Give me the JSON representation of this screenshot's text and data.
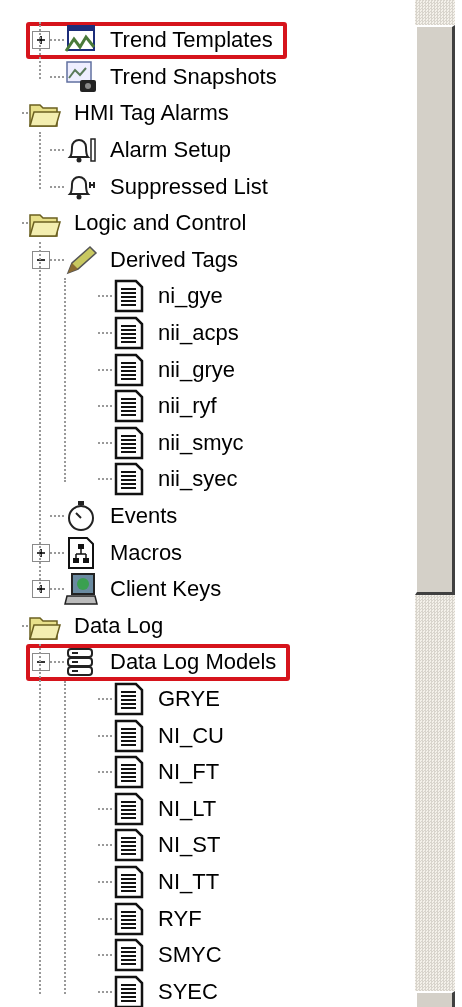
{
  "tree": [
    {
      "children": [
        {
          "label": "Trend Templates",
          "kind": "chart",
          "expanded": false,
          "highlighted": true
        },
        {
          "label": "Trend Snapshots",
          "kind": "snapshot",
          "highlighted": false
        }
      ]
    },
    {
      "label": "HMI Tag Alarms",
      "kind": "folder",
      "highlighted": false,
      "children": [
        {
          "label": "Alarm Setup",
          "kind": "bell",
          "highlighted": false
        },
        {
          "label": "Suppressed List",
          "kind": "bell-muted",
          "highlighted": false
        }
      ]
    },
    {
      "label": "Logic and Control",
      "kind": "folder",
      "highlighted": false,
      "children": [
        {
          "label": "Derived Tags",
          "kind": "pencil",
          "expanded": true,
          "highlighted": false,
          "children": [
            {
              "label": "ni_gye",
              "kind": "document",
              "highlighted": false
            },
            {
              "label": "nii_acps",
              "kind": "document",
              "highlighted": false
            },
            {
              "label": "nii_grye",
              "kind": "document",
              "highlighted": false
            },
            {
              "label": "nii_ryf",
              "kind": "document",
              "highlighted": false
            },
            {
              "label": "nii_smyc",
              "kind": "document",
              "highlighted": false
            },
            {
              "label": "nii_syec",
              "kind": "document",
              "highlighted": false
            }
          ]
        },
        {
          "label": "Events",
          "kind": "stopwatch",
          "highlighted": false
        },
        {
          "label": "Macros",
          "kind": "hierarchy",
          "expanded": false,
          "highlighted": false
        },
        {
          "label": "Client Keys",
          "kind": "computer",
          "expanded": false,
          "highlighted": false
        }
      ]
    },
    {
      "label": "Data Log",
      "kind": "folder",
      "highlighted": false,
      "children": [
        {
          "label": "Data Log Models",
          "kind": "database",
          "expanded": true,
          "highlighted": true,
          "children": [
            {
              "label": "GRYE",
              "kind": "document",
              "highlighted": false
            },
            {
              "label": "NI_CU",
              "kind": "document",
              "highlighted": false
            },
            {
              "label": "NI_FT",
              "kind": "document",
              "highlighted": false
            },
            {
              "label": "NI_LT",
              "kind": "document",
              "highlighted": false
            },
            {
              "label": "NI_ST",
              "kind": "document",
              "highlighted": false
            },
            {
              "label": "NI_TT",
              "kind": "document",
              "highlighted": false
            },
            {
              "label": "RYF",
              "kind": "document",
              "highlighted": false
            },
            {
              "label": "SMYC",
              "kind": "document",
              "highlighted": false
            },
            {
              "label": "SYEC",
              "kind": "document",
              "highlighted": false
            }
          ]
        }
      ]
    }
  ]
}
